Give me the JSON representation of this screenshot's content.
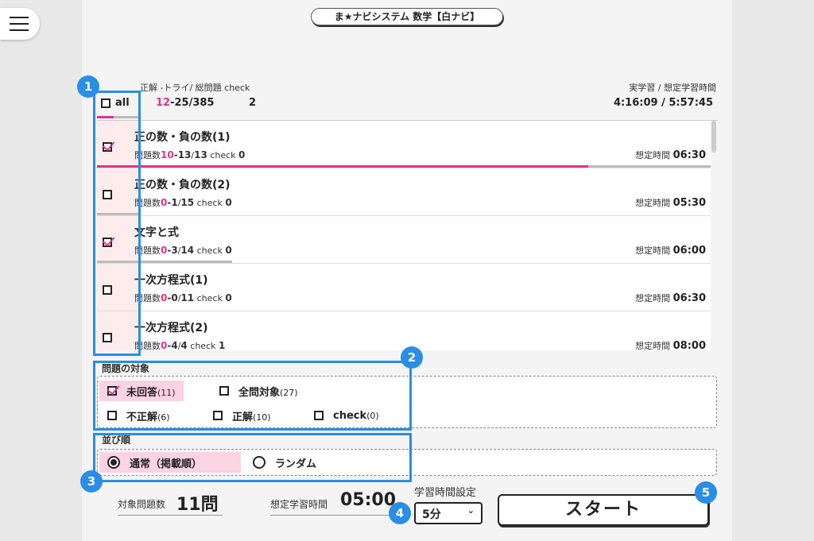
{
  "app_title": "ま★ナビシステム 数学【白ナビ】",
  "header": {
    "labels": "正解 -トライ/ 総問題  check",
    "study_time_label": "実学習 / 想定学習時間",
    "all_label": "all",
    "correct": "12",
    "tried": "-25",
    "total": "/385",
    "check": "2",
    "study_time": "4:16:09 / 5:57:45",
    "progress": 0.4
  },
  "units": [
    {
      "name": "正の数・負の数(1)",
      "checked": true,
      "correct": "10",
      "tried": "13",
      "total": "13",
      "check": "0",
      "est_time": "06:30",
      "progress": 0.8,
      "tried_frac": 1.0
    },
    {
      "name": "正の数・負の数(2)",
      "checked": false,
      "correct": "0",
      "tried": "1",
      "total": "15",
      "check": "0",
      "est_time": "05:30",
      "progress": 0,
      "tried_frac": 0.07
    },
    {
      "name": "文字と式",
      "checked": true,
      "correct": "0",
      "tried": "3",
      "total": "14",
      "check": "0",
      "est_time": "06:00",
      "progress": 0,
      "tried_frac": 0.22
    },
    {
      "name": "一次方程式(1)",
      "checked": false,
      "correct": "0",
      "tried": "0",
      "total": "11",
      "check": "0",
      "est_time": "06:30",
      "progress": 0,
      "tried_frac": 0
    },
    {
      "name": "一次方程式(2)",
      "checked": false,
      "correct": "0",
      "tried": "4",
      "total": "4",
      "check": "1",
      "est_time": "08:00",
      "progress": 0,
      "tried_frac": 1.0
    }
  ],
  "unit_labels": {
    "count": "問題数",
    "check": "check",
    "est": "想定時間"
  },
  "target": {
    "label": "問題の対象",
    "options": [
      {
        "label": "未回答",
        "count": "(11)",
        "checked": true
      },
      {
        "label": "全問対象",
        "count": "(27)",
        "checked": false
      },
      {
        "label": "不正解",
        "count": "(6)",
        "checked": false
      },
      {
        "label": "正解",
        "count": "(10)",
        "checked": false
      },
      {
        "label": "check",
        "count": "(0)",
        "checked": false
      }
    ]
  },
  "order": {
    "label": "並び順",
    "options": [
      {
        "label": "通常（掲載順）",
        "selected": true
      },
      {
        "label": "ランダム",
        "selected": false
      }
    ]
  },
  "footer": {
    "target_count_label": "対象問題数",
    "target_count": "11問",
    "est_time_label": "想定学習時間",
    "est_time": "05:00",
    "time_setting_label": "学習時間設定",
    "time_setting_value": "5分",
    "start_label": "スタート"
  },
  "guides": [
    "1",
    "2",
    "3",
    "4",
    "5"
  ],
  "colors": {
    "accent": "#e0338f",
    "guide": "#2a8de6",
    "selected_bg": "#fbd3e3"
  }
}
